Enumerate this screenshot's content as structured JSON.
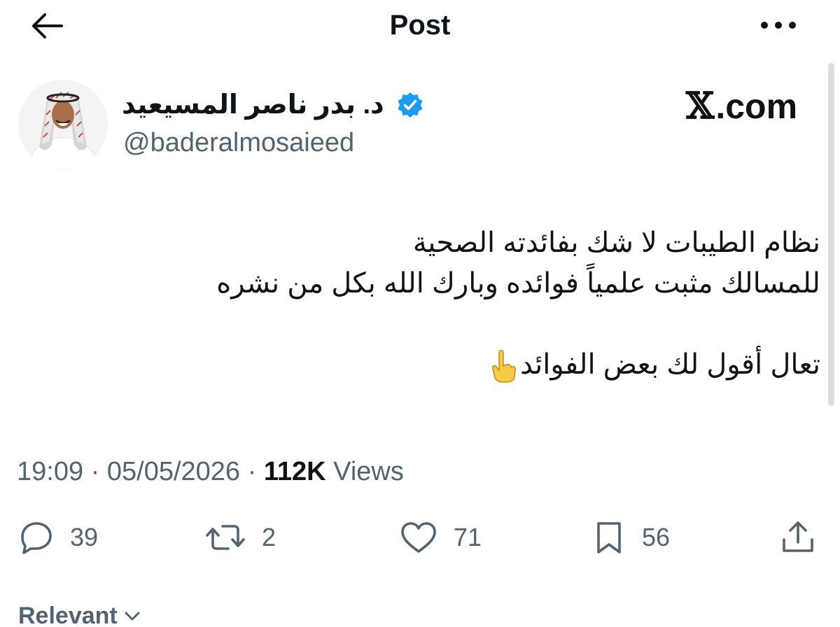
{
  "header": {
    "title": "Post",
    "back_icon": "arrow-left-icon",
    "more_icon": "more-horizontal-icon"
  },
  "author": {
    "display_name": "د. بدر ناصر المسيعيد",
    "handle": "@baderalmosaieed",
    "verified": true,
    "verified_color": "#1d9bf0"
  },
  "watermark": {
    "glyph": "𝕏",
    "text": ".com"
  },
  "tweet": {
    "lines": [
      "نظام الطيبات لا شك بفائدته الصحية",
      "للمسالك مثبت علمياً فوائده وبارك الله بكل من نشره",
      "",
      "تعال أقول لك بعض الفوائد"
    ],
    "emoji": "hand-pointing-down-icon"
  },
  "meta": {
    "time": "19:09",
    "separator": "·",
    "date": "05/05/2026",
    "views_count": "112K",
    "views_label": "Views"
  },
  "actions": {
    "replies": "39",
    "reposts": "2",
    "likes": "71",
    "bookmarks": "56"
  },
  "replies_sort": {
    "label": "Relevant"
  },
  "colors": {
    "text": "#0f1419",
    "secondary": "#536471",
    "accent": "#1d9bf0"
  }
}
